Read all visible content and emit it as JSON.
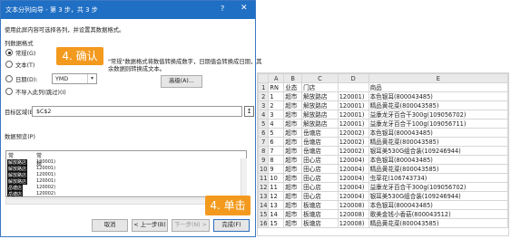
{
  "dialog": {
    "title": "文本分列向导 - 第 3 步，共 3 步",
    "help": "?",
    "close": "✕",
    "intro": "使用此屏内容可选择各列，并设置其数据格式。",
    "column_format_label": "列数据格式",
    "formats": [
      {
        "label": "常规(G)",
        "selected": true
      },
      {
        "label": "文本(T)",
        "selected": false
      },
      {
        "label": "日期(D):",
        "selected": false
      },
      {
        "label": "不导入此列(跳过)(I)",
        "selected": false
      }
    ],
    "date_format": "YMD",
    "note_line1": "\"常规\"数据格式将数值转换成数字，日期值会转换成日期，其",
    "note_line2": "余数据则转换成文本。",
    "advanced_button": "高级(A)...",
    "destination_label": "目标区域(E):",
    "destination_value": "$C$2",
    "preview_label": "数据预览(P)",
    "preview_headers": [
      "常规",
      "常规"
    ],
    "preview_rows": [
      {
        "a": "解放路店",
        "b": "120001)"
      },
      {
        "a": "解放路店",
        "b": "120001)"
      },
      {
        "a": "解放路店",
        "b": "120001)"
      },
      {
        "a": "解放路店",
        "b": "120001)"
      },
      {
        "a": "岳塘店",
        "b": "120002)"
      },
      {
        "a": "岳塘店",
        "b": "120002)"
      }
    ],
    "buttons": {
      "cancel": "取消",
      "back": "< 上一步(B)",
      "next": "下一步(N) >",
      "finish": "完成(F)"
    }
  },
  "callouts": {
    "step_confirm": "4. 确认",
    "step_click": "4. 单击"
  },
  "spreadsheet": {
    "corner": "",
    "columns": [
      "A",
      "B",
      "C",
      "D",
      "E"
    ],
    "row_numbers": [
      "1",
      "2",
      "3",
      "4",
      "5",
      "6",
      "7",
      "8",
      "9",
      "10",
      "11",
      "12",
      "13",
      "14",
      "15",
      "16"
    ],
    "rows": [
      [
        "RN",
        "业态",
        "门店",
        "",
        "商品"
      ],
      [
        "1",
        "超市",
        "解放路店",
        "120001)",
        "本色银耳(800043485)"
      ],
      [
        "2",
        "超市",
        "解放路店",
        "120001)",
        "精品黄花菜(800043585)"
      ],
      [
        "3",
        "超市",
        "解放路店",
        "120001)",
        "益康龙牙百合干300g(109056702)"
      ],
      [
        "4",
        "超市",
        "解放路店",
        "120001)",
        "益康龙牙百合干100g(109056711)"
      ],
      [
        "5",
        "超市",
        "岳塘店",
        "120002)",
        "本色银耳(800043485)"
      ],
      [
        "6",
        "超市",
        "岳塘店",
        "120002)",
        "精品黄花菜(800043585)"
      ],
      [
        "7",
        "超市",
        "岳塘店",
        "120002)",
        "银耳美530G组合装(109246944)"
      ],
      [
        "8",
        "超市",
        "田心店",
        "120004)",
        "本色银耳(800043485)"
      ],
      [
        "9",
        "超市",
        "田心店",
        "120004)",
        "精品黄花菜(800043585)"
      ],
      [
        "10",
        "超市",
        "田心店",
        "120004)",
        "虫草花(106743734)"
      ],
      [
        "11",
        "超市",
        "田心店",
        "120004)",
        "益康龙牙百合干300g(109056702)"
      ],
      [
        "12",
        "超市",
        "田心店",
        "120004)",
        "银耳美530G组合装(109246944)"
      ],
      [
        "13",
        "超市",
        "板塘店",
        "120008)",
        "本色银耳(800043485)"
      ],
      [
        "14",
        "超市",
        "板塘店",
        "120008)",
        "歌美金钱小香菇(800043512)"
      ],
      [
        "15",
        "超市",
        "板塘店",
        "120008)",
        "精品黄花菜(800043585)"
      ]
    ]
  }
}
